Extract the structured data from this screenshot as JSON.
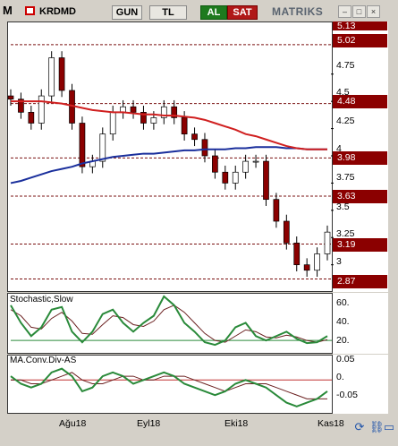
{
  "toolbar": {
    "logo": "M",
    "symbol": "KRDMD",
    "period_daily": "GUN",
    "currency": "TL",
    "buy": "AL",
    "sell": "SAT",
    "brand": "MATRIKS",
    "win_min": "–",
    "win_max": "□",
    "win_close": "×"
  },
  "main_chart": {
    "price_tags": [
      "5.13",
      "5.02",
      "4.48",
      "3.98",
      "3.63",
      "3.19",
      "2.87"
    ],
    "tick_labels": [
      "4.75",
      "4.5",
      "4.25",
      "4",
      "3.75",
      "3.5",
      "3.25",
      "3"
    ]
  },
  "stochastic": {
    "title": "Stochastic,Slow",
    "ticks": [
      "60.",
      "40.",
      "20."
    ]
  },
  "macd": {
    "title": "MA.Conv.Div-AS",
    "ticks": [
      "0.05",
      "0.",
      "-0.05"
    ]
  },
  "x_axis": {
    "labels": [
      "Ağu18",
      "Eyl18",
      "Eki18",
      "Kas18"
    ]
  },
  "colors": {
    "ma_short": "#d02020",
    "ma_long": "#1a2f9c",
    "up_candle": "#ffffff",
    "down_candle": "#8b0000",
    "stoch_k": "#2a8a3a",
    "stoch_d": "#6b2020"
  },
  "chart_data": [
    {
      "type": "candlestick",
      "title": "KRDMD",
      "ylim": [
        2.8,
        5.2
      ],
      "x": [
        "Ağu18",
        "Eyl18",
        "Eki18",
        "Kas18"
      ],
      "series": [
        {
          "name": "close",
          "values": [
            4.52,
            4.4,
            4.3,
            4.55,
            4.9,
            4.6,
            4.3,
            3.9,
            3.95,
            4.2,
            4.4,
            4.45,
            4.4,
            4.3,
            4.35,
            4.45,
            4.35,
            4.2,
            4.15,
            4.0,
            3.85,
            3.75,
            3.85,
            3.95,
            3.95,
            3.6,
            3.4,
            3.2,
            3.0,
            2.95,
            3.1,
            3.3
          ]
        },
        {
          "name": "ma_long",
          "values": [
            3.75,
            3.77,
            3.8,
            3.83,
            3.86,
            3.88,
            3.9,
            3.93,
            3.95,
            3.97,
            3.99,
            4.0,
            4.01,
            4.02,
            4.02,
            4.03,
            4.04,
            4.05,
            4.05,
            4.06,
            4.06,
            4.06,
            4.07,
            4.07,
            4.08,
            4.08,
            4.08,
            4.07,
            4.07,
            4.06,
            4.06,
            4.06
          ]
        },
        {
          "name": "ma_mid",
          "values": [
            4.5,
            4.5,
            4.5,
            4.5,
            4.49,
            4.48,
            4.46,
            4.44,
            4.42,
            4.41,
            4.4,
            4.4,
            4.39,
            4.38,
            4.38,
            4.37,
            4.37,
            4.36,
            4.35,
            4.33,
            4.3,
            4.27,
            4.24,
            4.2,
            4.18,
            4.15,
            4.12,
            4.09,
            4.07,
            4.06,
            4.06,
            4.06
          ]
        }
      ]
    },
    {
      "type": "line",
      "title": "Stochastic,Slow",
      "ylim": [
        10,
        70
      ],
      "series": [
        {
          "name": "K",
          "values": [
            60,
            40,
            25,
            35,
            55,
            58,
            30,
            18,
            30,
            50,
            55,
            40,
            30,
            40,
            48,
            70,
            60,
            40,
            30,
            18,
            15,
            20,
            35,
            40,
            25,
            20,
            25,
            30,
            22,
            17,
            18,
            25
          ]
        },
        {
          "name": "D",
          "values": [
            55,
            48,
            35,
            33,
            45,
            52,
            42,
            28,
            27,
            38,
            48,
            46,
            38,
            36,
            42,
            55,
            60,
            52,
            40,
            28,
            20,
            18,
            25,
            32,
            30,
            24,
            23,
            26,
            24,
            20,
            18,
            21
          ]
        }
      ]
    },
    {
      "type": "line",
      "title": "MA.Conv.Div-AS",
      "ylim": [
        -0.08,
        0.06
      ],
      "series": [
        {
          "name": "MACD",
          "values": [
            0.01,
            -0.01,
            -0.02,
            -0.01,
            0.02,
            0.03,
            0.01,
            -0.03,
            -0.02,
            0.01,
            0.02,
            0.01,
            -0.01,
            0.0,
            0.01,
            0.02,
            0.01,
            -0.01,
            -0.02,
            -0.03,
            -0.04,
            -0.03,
            -0.01,
            0.0,
            -0.01,
            -0.02,
            -0.04,
            -0.06,
            -0.07,
            -0.06,
            -0.05,
            -0.03
          ]
        },
        {
          "name": "Signal",
          "values": [
            0.0,
            0.0,
            -0.01,
            -0.01,
            0.0,
            0.01,
            0.02,
            0.0,
            -0.01,
            -0.01,
            0.0,
            0.01,
            0.01,
            0.0,
            0.0,
            0.01,
            0.01,
            0.01,
            0.0,
            -0.01,
            -0.02,
            -0.03,
            -0.02,
            -0.01,
            -0.01,
            -0.01,
            -0.02,
            -0.03,
            -0.04,
            -0.05,
            -0.05,
            -0.05
          ]
        }
      ]
    }
  ]
}
